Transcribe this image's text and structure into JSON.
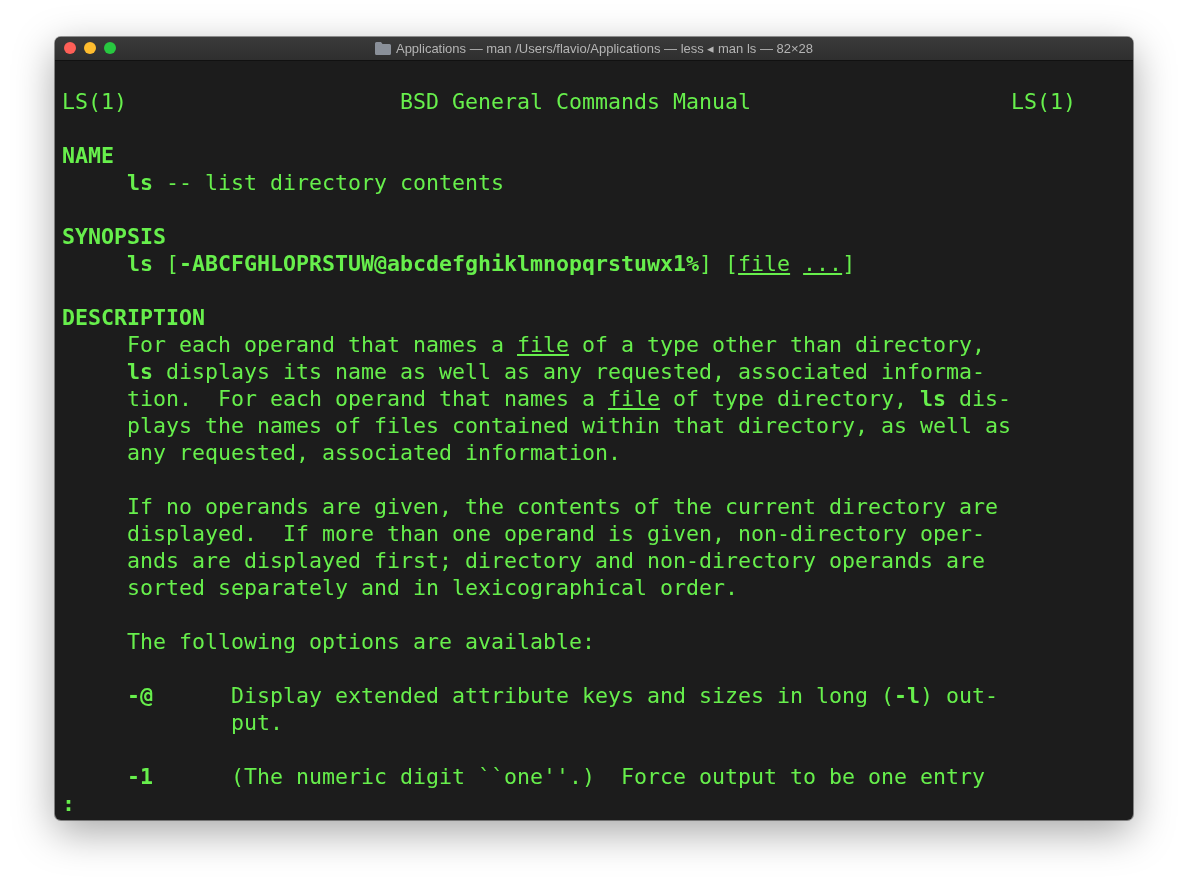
{
  "window": {
    "title": "Applications — man /Users/flavio/Applications — less ◂ man ls — 82×28"
  },
  "terminal": {
    "lines": [
      {
        "kind": "blank"
      },
      {
        "kind": "header",
        "text": "LS(1)                     BSD General Commands Manual                    LS(1)"
      },
      {
        "kind": "blank"
      },
      {
        "kind": "heading",
        "text": "NAME"
      },
      {
        "kind": "body",
        "text": "**ls** -- list directory contents"
      },
      {
        "kind": "blank"
      },
      {
        "kind": "heading",
        "text": "SYNOPSIS"
      },
      {
        "kind": "body",
        "segments": [
          {
            "t": "**ls** [**-ABCFGHLOPRSTUW@abcdefghiklmnopqrstuwx1%**] [",
            "kind": "plain"
          },
          {
            "t": "file ...",
            "kind": "underline"
          },
          {
            "t": "]",
            "kind": "plain"
          }
        ]
      },
      {
        "kind": "blank"
      },
      {
        "kind": "heading",
        "text": "DESCRIPTION"
      },
      {
        "kind": "body",
        "segments": [
          {
            "t": "For each operand that names a ",
            "kind": "plain"
          },
          {
            "t": "file",
            "kind": "underline"
          },
          {
            "t": " of a type other than directory,",
            "kind": "plain"
          }
        ]
      },
      {
        "kind": "body",
        "text": "**ls** displays its name as well as any requested, associated informa-"
      },
      {
        "kind": "body",
        "segments": [
          {
            "t": "tion.  For each operand that names a ",
            "kind": "plain"
          },
          {
            "t": "file",
            "kind": "underline"
          },
          {
            "t": " of type directory, **ls** dis-",
            "kind": "plain"
          }
        ]
      },
      {
        "kind": "body",
        "text": "plays the names of files contained within that directory, as well as"
      },
      {
        "kind": "body",
        "text": "any requested, associated information."
      },
      {
        "kind": "blank"
      },
      {
        "kind": "body",
        "text": "If no operands are given, the contents of the current directory are"
      },
      {
        "kind": "body",
        "text": "displayed.  If more than one operand is given, non-directory oper-"
      },
      {
        "kind": "body",
        "text": "ands are displayed first; directory and non-directory operands are"
      },
      {
        "kind": "body",
        "text": "sorted separately and in lexicographical order."
      },
      {
        "kind": "blank"
      },
      {
        "kind": "body",
        "text": "The following options are available:"
      },
      {
        "kind": "blank"
      },
      {
        "kind": "body",
        "text": "**-@**      Display extended attribute keys and sizes in long (**-l**) out-"
      },
      {
        "kind": "continuation",
        "text": "put."
      },
      {
        "kind": "blank"
      },
      {
        "kind": "body",
        "text": "**-1**      (The numeric digit ``one''.)  Force output to be one entry"
      },
      {
        "kind": "prompt",
        "text": ":"
      }
    ]
  }
}
